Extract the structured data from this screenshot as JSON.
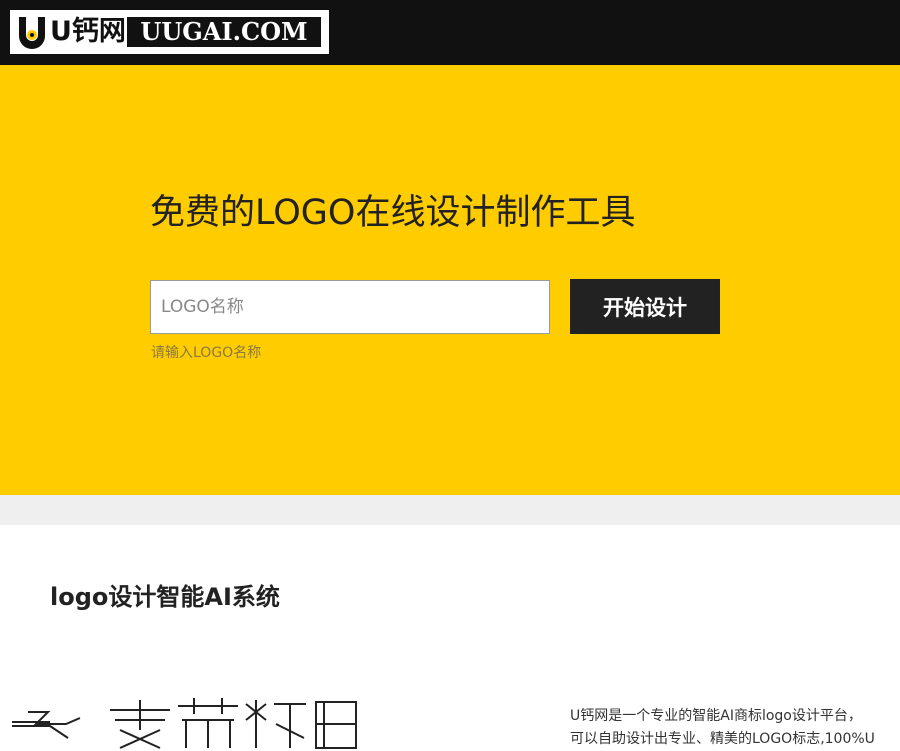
{
  "header": {
    "logo_cn": "U钙网",
    "logo_en": "UUGAI.COM"
  },
  "hero": {
    "title": "免费的LOGO在线设计制作工具",
    "input_placeholder": "LOGO名称",
    "input_value": "",
    "start_button": "开始设计",
    "hint": "请输入LOGO名称"
  },
  "section": {
    "title": "logo设计智能AI系统",
    "desc_line1": "U钙网是一个专业的智能AI商标logo设计平台，",
    "desc_line2": "可以自助设计出专业、精美的LOGO标志,100%U"
  },
  "colors": {
    "header_bg": "#111111",
    "hero_bg": "#ffcc00",
    "button_bg": "#222222",
    "band_bg": "#efefef"
  },
  "icons": {
    "logo_mark": "gear-u-icon"
  }
}
